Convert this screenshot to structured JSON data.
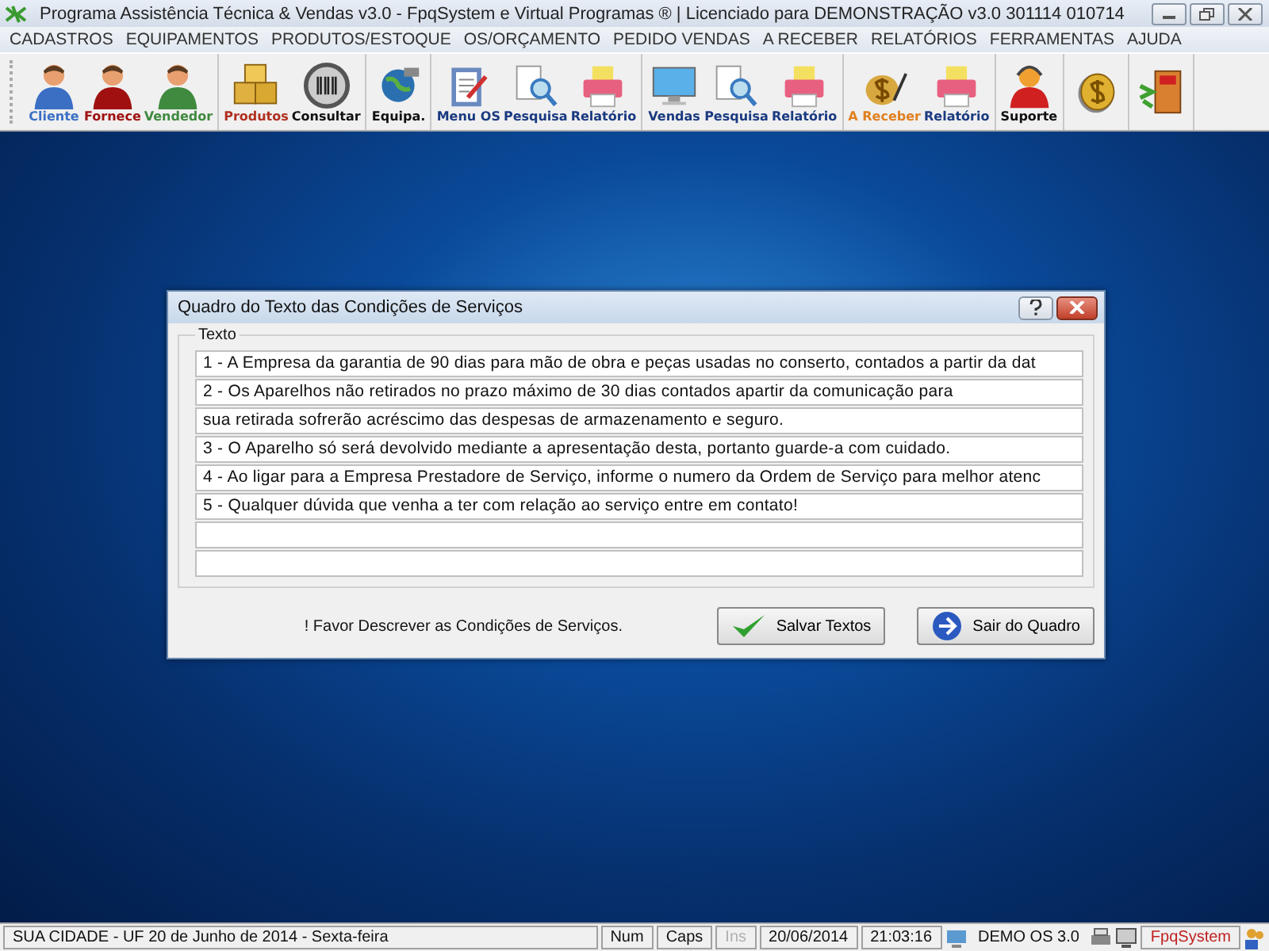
{
  "window": {
    "title": "Programa Assistência Técnica & Vendas v3.0 - FpqSystem e Virtual Programas ® | Licenciado para  DEMONSTRAÇÃO v3.0 301114 010714"
  },
  "menu": [
    "CADASTROS",
    "EQUIPAMENTOS",
    "PRODUTOS/ESTOQUE",
    "OS/ORÇAMENTO",
    "PEDIDO VENDAS",
    "A RECEBER",
    "RELATÓRIOS",
    "FERRAMENTAS",
    "AJUDA"
  ],
  "toolbar": [
    [
      {
        "label": "Cliente",
        "kind": "person",
        "color": "#3a6fc4"
      },
      {
        "label": "Fornece",
        "kind": "person",
        "color": "#a01010"
      },
      {
        "label": "Vendedor",
        "kind": "person",
        "color": "#3f8a3f"
      }
    ],
    [
      {
        "label": "Produtos",
        "kind": "boxes",
        "color": "#b03020"
      },
      {
        "label": "Consultar",
        "kind": "barcode",
        "color": "#101010"
      }
    ],
    [
      {
        "label": "Equipa.",
        "kind": "globe",
        "color": "#101010"
      }
    ],
    [
      {
        "label": "Menu OS",
        "kind": "clipboard",
        "color": "#1a3a80"
      },
      {
        "label": "Pesquisa",
        "kind": "search",
        "color": "#1a3a80"
      },
      {
        "label": "Relatório",
        "kind": "printer",
        "color": "#1a3a80"
      }
    ],
    [
      {
        "label": "Vendas",
        "kind": "monitor",
        "color": "#1a3a80"
      },
      {
        "label": "Pesquisa",
        "kind": "search",
        "color": "#1a3a80"
      },
      {
        "label": "Relatório",
        "kind": "printer",
        "color": "#1a3a80"
      }
    ],
    [
      {
        "label": "A Receber",
        "kind": "money",
        "color": "#e08020"
      },
      {
        "label": "Relatório",
        "kind": "printer",
        "color": "#1a3a80"
      }
    ],
    [
      {
        "label": "Suporte",
        "kind": "support",
        "color": "#101010"
      }
    ],
    [
      {
        "kind": "coin"
      }
    ],
    [
      {
        "kind": "exit"
      }
    ]
  ],
  "dialog": {
    "title": "Quadro do Texto das Condições de Serviços",
    "group_label": "Texto",
    "lines": [
      {
        "kind": "text",
        "value": "1 - A Empresa da garantia de 90 dias para mão de obra e peças usadas no conserto, contados  a partir da dat"
      },
      {
        "kind": "text",
        "value": "2 - Os Aparelhos não retirados no prazo máximo de 30 dias contados apartir da comunicação para"
      },
      {
        "kind": "text",
        "value": "sua retirada sofrerão acréscimo das despesas de armazenamento e seguro."
      },
      {
        "kind": "text",
        "value": "3 - O Aparelho só será devolvido mediante a apresentação desta, portanto guarde-a com cuidado."
      },
      {
        "kind": "text",
        "value": "4 - Ao ligar para a Empresa Prestadore de Serviço, informe o numero da Ordem de Serviço para melhor atenc"
      },
      {
        "kind": "text",
        "value": "5 - Qualquer dúvida que venha a ter com relação ao serviço entre em contato!"
      },
      {
        "kind": "blank"
      },
      {
        "kind": "blank"
      }
    ],
    "hint": "! Favor Descrever as Condições de Serviços.",
    "buttons": [
      {
        "label": "Salvar Textos",
        "kind": "save"
      },
      {
        "label": "Sair do Quadro",
        "kind": "exit"
      }
    ]
  },
  "status_bar": {
    "location": "SUA CIDADE - UF 20 de Junho de 2014 - Sexta-feira",
    "keys": [
      {
        "label": "Num",
        "disabled": false
      },
      {
        "label": "Caps",
        "disabled": false
      },
      {
        "label": "Ins",
        "disabled": true
      }
    ],
    "date": "20/06/2014",
    "time": "21:03:16",
    "version": "DEMO OS 3.0",
    "brand": "FpqSystem"
  }
}
